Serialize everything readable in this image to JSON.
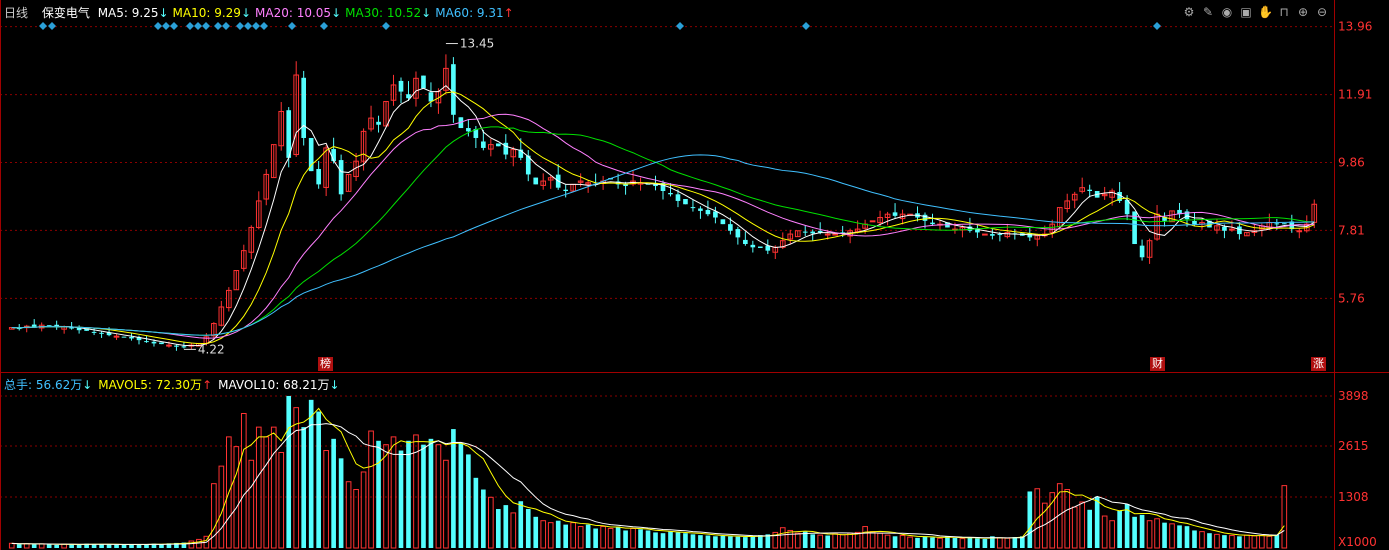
{
  "header": {
    "period": "日线",
    "stock_name": "保变电气",
    "ma": [
      {
        "label": "MA5: 9.25",
        "arrow": "↓",
        "color": "#ffffff"
      },
      {
        "label": "MA10: 9.29",
        "arrow": "↓",
        "color": "#ffff00"
      },
      {
        "label": "MA20: 10.05",
        "arrow": "↓",
        "color": "#ff80ff"
      },
      {
        "label": "MA30: 10.52",
        "arrow": "↓",
        "color": "#00e000"
      },
      {
        "label": "MA60: 9.31",
        "arrow": "↑",
        "color": "#40c0ff"
      }
    ]
  },
  "volume_header": {
    "items": [
      {
        "label": "总手: 56.62万",
        "arrow": "↓",
        "color": "#40c0ff"
      },
      {
        "label": "MAVOL5: 72.30万",
        "arrow": "↑",
        "color": "#ffff00"
      },
      {
        "label": "MAVOL10: 68.21万",
        "arrow": "↓",
        "color": "#ffffff"
      }
    ]
  },
  "toolbar_icons": [
    "settings-icon",
    "pen-icon",
    "eye-icon",
    "briefcase-icon",
    "hand-icon",
    "lock-icon",
    "zoom-in-icon",
    "zoom-out-icon"
  ],
  "markers": {
    "bang": "榜",
    "cai": "财",
    "zhang": "涨"
  },
  "colors": {
    "up": "#ff3232",
    "down": "#54ffff",
    "grid": "#8a0000",
    "axis": "#c00000",
    "ma5": "#ffffff",
    "ma10": "#ffff00",
    "ma20": "#ff80ff",
    "ma30": "#00e000",
    "ma60": "#40c0ff"
  },
  "chart_data": [
    {
      "type": "candlestick",
      "title": "日线",
      "y_axis_ticks": [
        5.76,
        7.81,
        9.86,
        11.91,
        13.96
      ],
      "ylim": [
        3.9,
        14.1
      ],
      "annotations": [
        {
          "label": "13.45",
          "value": 13.45
        },
        {
          "label": "4.22",
          "value": 4.22
        }
      ],
      "series_name": "保变电气",
      "close": [
        4.88,
        4.86,
        4.92,
        4.9,
        4.95,
        4.93,
        4.88,
        4.9,
        4.85,
        4.8,
        4.78,
        4.72,
        4.7,
        4.65,
        4.62,
        4.58,
        4.55,
        4.5,
        4.45,
        4.4,
        4.38,
        4.35,
        4.3,
        4.28,
        4.35,
        4.4,
        4.6,
        5.0,
        5.5,
        6.0,
        6.6,
        7.2,
        7.9,
        8.7,
        9.5,
        10.4,
        11.4,
        10.0,
        12.5,
        10.6,
        9.6,
        9.2,
        10.3,
        9.9,
        8.9,
        9.5,
        9.9,
        10.8,
        11.2,
        11.0,
        11.7,
        12.2,
        12.0,
        11.8,
        12.4,
        12.1,
        11.7,
        12.0,
        12.7,
        11.3,
        10.9,
        10.8,
        10.6,
        10.3,
        10.4,
        10.35,
        10.1,
        10.25,
        10.0,
        9.5,
        9.2,
        9.3,
        9.4,
        9.1,
        9.0,
        9.2,
        9.3,
        9.25,
        9.2,
        9.3,
        9.35,
        9.2,
        9.15,
        9.3,
        9.25,
        9.2,
        9.15,
        9.0,
        8.9,
        8.7,
        8.6,
        8.5,
        8.4,
        8.3,
        8.2,
        8.0,
        7.8,
        7.6,
        7.4,
        7.3,
        7.28,
        7.2,
        7.3,
        7.5,
        7.7,
        7.8,
        7.75,
        7.72,
        7.75,
        7.7,
        7.7,
        7.72,
        7.8,
        7.85,
        8.0,
        8.1,
        8.2,
        8.3,
        8.25,
        8.3,
        8.3,
        8.2,
        8.1,
        8.0,
        8.0,
        7.9,
        7.85,
        7.9,
        7.8,
        7.75,
        7.7,
        7.65,
        7.7,
        7.75,
        7.7,
        7.65,
        7.6,
        7.65,
        7.7,
        8.0,
        8.5,
        8.7,
        8.9,
        9.1,
        9.0,
        8.8,
        8.9,
        9.0,
        8.7,
        8.3,
        7.4,
        7.0,
        7.5,
        8.3,
        8.1,
        8.4,
        8.3,
        8.15,
        8.0,
        8.05,
        7.9,
        7.95,
        7.8,
        7.85,
        7.7,
        7.75,
        7.8,
        7.95,
        8.05,
        8.0,
        8.0,
        7.85,
        7.8,
        8.0,
        8.6
      ],
      "ma_last": {
        "MA5": 9.25,
        "MA10": 9.29,
        "MA20": 10.05,
        "MA30": 10.52,
        "MA60": 9.31
      }
    },
    {
      "type": "bar",
      "title": "总手",
      "y_axis_ticks": [
        1308,
        2615,
        3898
      ],
      "y_axis_labels": [
        "1308",
        "2615",
        "3898",
        "X1000"
      ],
      "ylim": [
        0,
        3950
      ],
      "values": [
        120,
        100,
        110,
        90,
        105,
        95,
        80,
        100,
        90,
        85,
        110,
        95,
        100,
        90,
        85,
        80,
        90,
        100,
        95,
        110,
        90,
        120,
        130,
        140,
        180,
        220,
        300,
        1650,
        2100,
        2850,
        2600,
        3450,
        2250,
        3100,
        2850,
        3100,
        2450,
        3900,
        3600,
        3100,
        3800,
        3500,
        2500,
        2800,
        2300,
        1700,
        1500,
        1950,
        3000,
        2750,
        2650,
        2850,
        2500,
        2750,
        2900,
        2650,
        2800,
        2650,
        2250,
        3050,
        2700,
        2400,
        1800,
        1500,
        1300,
        1000,
        1100,
        900,
        1200,
        1000,
        800,
        700,
        650,
        700,
        600,
        650,
        550,
        600,
        500,
        550,
        500,
        550,
        450,
        500,
        480,
        450,
        400,
        380,
        420,
        400,
        380,
        350,
        330,
        320,
        300,
        310,
        300,
        290,
        280,
        300,
        330,
        350,
        400,
        520,
        450,
        380,
        420,
        350,
        330,
        320,
        360,
        340,
        380,
        400,
        550,
        420,
        380,
        330,
        300,
        320,
        280,
        260,
        300,
        270,
        250,
        300,
        260,
        240,
        270,
        250,
        230,
        300,
        260,
        250,
        280,
        300,
        1450,
        1520,
        1150,
        1420,
        1650,
        1500,
        1050,
        1180,
        980,
        1320,
        820,
        700,
        950,
        1130,
        800,
        850,
        700,
        750,
        650,
        620,
        580,
        560,
        450,
        420,
        380,
        350,
        330,
        320,
        300,
        330,
        310,
        320,
        300,
        340,
        1600
      ],
      "ma_last": {
        "MAVOL5": 72.3,
        "MAVOL10": 68.21
      }
    }
  ]
}
